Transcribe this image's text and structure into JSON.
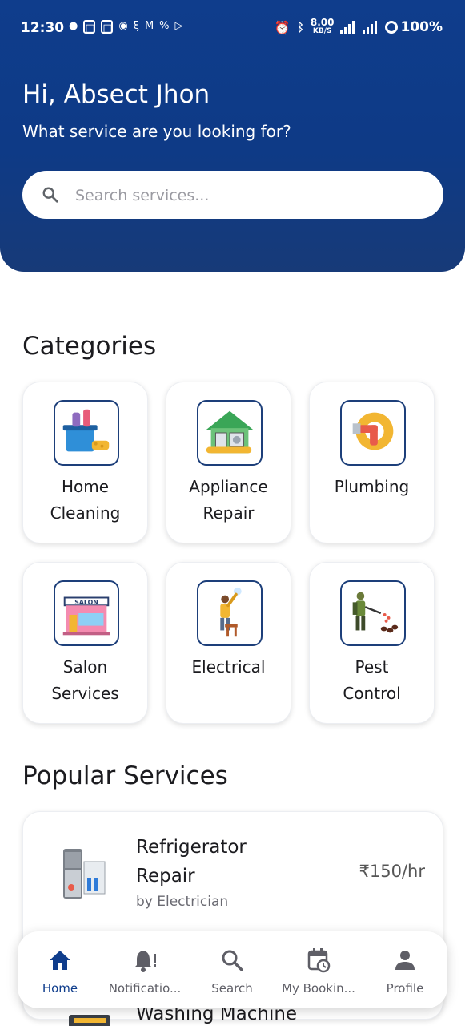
{
  "status_bar": {
    "time": "12:30",
    "speed": "8.00",
    "speed_unit": "KB/S",
    "battery": "100%"
  },
  "header": {
    "greeting": "Hi, Absect Jhon",
    "subtitle": "What service are you looking for?",
    "search_placeholder": "Search services..."
  },
  "categories": {
    "title": "Categories",
    "items": [
      {
        "label_line1": "Home",
        "label_line2": "Cleaning",
        "icon": "home-cleaning-icon"
      },
      {
        "label_line1": "Appliance",
        "label_line2": "Repair",
        "icon": "appliance-repair-icon"
      },
      {
        "label_line1": "Plumbing",
        "label_line2": "",
        "icon": "plumbing-icon"
      },
      {
        "label_line1": "Salon",
        "label_line2": "Services",
        "icon": "salon-icon"
      },
      {
        "label_line1": "Electrical",
        "label_line2": "",
        "icon": "electrical-icon"
      },
      {
        "label_line1": "Pest",
        "label_line2": "Control",
        "icon": "pest-control-icon"
      }
    ],
    "salon_sign": "SALON"
  },
  "popular": {
    "title": "Popular Services",
    "items": [
      {
        "name_line1": "Refrigerator",
        "name_line2": "Repair",
        "by": "by Electrician",
        "price": "₹150/hr"
      },
      {
        "name_line1": "Washing Machine"
      }
    ]
  },
  "bottom_nav": {
    "active": "home",
    "items": [
      {
        "label": "Home",
        "icon": "home-icon"
      },
      {
        "label": "Notificatio...",
        "icon": "bell-alert-icon"
      },
      {
        "label": "Search",
        "icon": "search-icon"
      },
      {
        "label": "My Bookin...",
        "icon": "calendar-clock-icon"
      },
      {
        "label": "Profile",
        "icon": "person-icon"
      }
    ]
  },
  "colors": {
    "header": "#0f3d8c",
    "accent": "#0f3d8c",
    "card_border": "#1d3f7a"
  }
}
